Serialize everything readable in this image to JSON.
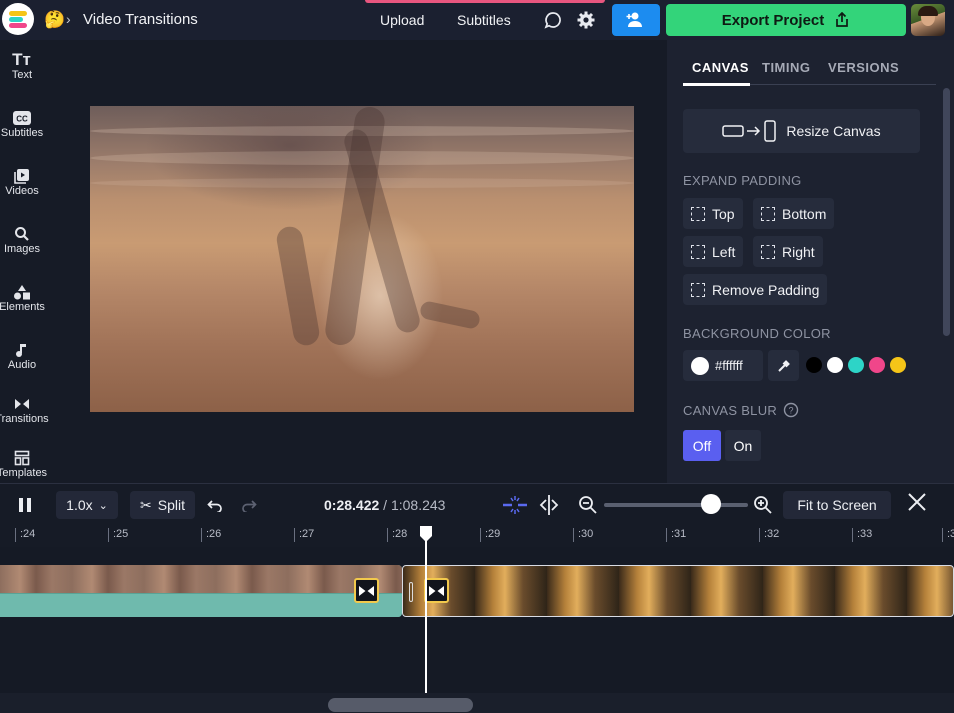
{
  "header": {
    "project_emoji": "🤔",
    "project_title": "Video Transitions",
    "upload_label": "Upload",
    "subtitles_label": "Subtitles",
    "export_label": "Export Project"
  },
  "sidebar": {
    "items": [
      {
        "label": "Text",
        "icon": "text-icon"
      },
      {
        "label": "Subtitles",
        "icon": "cc-icon"
      },
      {
        "label": "Videos",
        "icon": "video-icon"
      },
      {
        "label": "Images",
        "icon": "search-icon"
      },
      {
        "label": "Elements",
        "icon": "shapes-icon"
      },
      {
        "label": "Audio",
        "icon": "music-note-icon"
      },
      {
        "label": "Transitions",
        "icon": "transition-icon"
      },
      {
        "label": "Templates",
        "icon": "templates-icon"
      }
    ]
  },
  "panel": {
    "tabs": [
      "CANVAS",
      "TIMING",
      "VERSIONS"
    ],
    "active_tab": "CANVAS",
    "resize_label": "Resize Canvas",
    "expand_padding_label": "EXPAND PADDING",
    "padding_buttons": [
      "Top",
      "Bottom",
      "Left",
      "Right",
      "Remove Padding"
    ],
    "background_color_label": "BACKGROUND COLOR",
    "background_hex": "#ffffff",
    "swatches": [
      "#000000",
      "#ffffff",
      "#2dd4c7",
      "#f0468a",
      "#f5c518"
    ],
    "canvas_blur_label": "CANVAS BLUR",
    "blur_off": "Off",
    "blur_on": "On",
    "blur_selected": "Off"
  },
  "playback": {
    "speed": "1.0x",
    "split_label": "Split",
    "current_time": "0:28.422",
    "separator": " / ",
    "total_time": "1:08.243",
    "fit_label": "Fit to Screen"
  },
  "timeline": {
    "ticks": [
      ":24",
      ":25",
      ":26",
      ":27",
      ":28",
      ":29",
      ":30",
      ":31",
      ":32",
      ":33",
      ":3"
    ]
  },
  "colors": {
    "accent_blue": "#1c8cf0",
    "export_green": "#33d47a",
    "toggle_purple": "#5a5ff0",
    "transition_yellow": "#f2c94c"
  }
}
